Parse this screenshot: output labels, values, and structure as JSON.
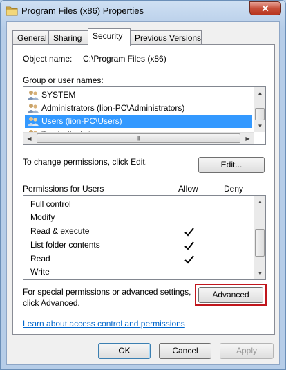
{
  "window": {
    "title": "Program Files (x86) Properties",
    "close_glyph": "✕"
  },
  "tabs": [
    {
      "label": "General",
      "active": false
    },
    {
      "label": "Sharing",
      "active": false
    },
    {
      "label": "Security",
      "active": true
    },
    {
      "label": "Previous Versions",
      "active": false
    }
  ],
  "security": {
    "object_name_label": "Object name:",
    "object_name_value": "C:\\Program Files (x86)",
    "group_label": "Group or user names:",
    "users": [
      {
        "name": "SYSTEM",
        "selected": false
      },
      {
        "name": "Administrators (lion-PC\\Administrators)",
        "selected": false
      },
      {
        "name": "Users (lion-PC\\Users)",
        "selected": true
      },
      {
        "name": "TrustedInstaller",
        "selected": false
      }
    ],
    "scroll_up": "▲",
    "scroll_down": "▼",
    "scroll_left": "◀",
    "scroll_right": "▶",
    "hthumb_grip": "|||",
    "change_text": "To change permissions, click Edit.",
    "edit_label": "Edit...",
    "permissions_label": "Permissions for Users",
    "allow_label": "Allow",
    "deny_label": "Deny",
    "permissions": [
      {
        "name": "Full control",
        "allow": false,
        "deny": false
      },
      {
        "name": "Modify",
        "allow": false,
        "deny": false
      },
      {
        "name": "Read & execute",
        "allow": true,
        "deny": false
      },
      {
        "name": "List folder contents",
        "allow": true,
        "deny": false
      },
      {
        "name": "Read",
        "allow": true,
        "deny": false
      },
      {
        "name": "Write",
        "allow": false,
        "deny": false
      }
    ],
    "special_text_line1": "For special permissions or advanced settings,",
    "special_text_line2": "click Advanced.",
    "advanced_label": "Advanced",
    "learn_link": "Learn about access control and permissions"
  },
  "footer": {
    "ok_label": "OK",
    "cancel_label": "Cancel",
    "apply_label": "Apply"
  },
  "colors": {
    "selection": "#3399ff",
    "link": "#0066cc",
    "highlight_border": "#c0161d"
  }
}
